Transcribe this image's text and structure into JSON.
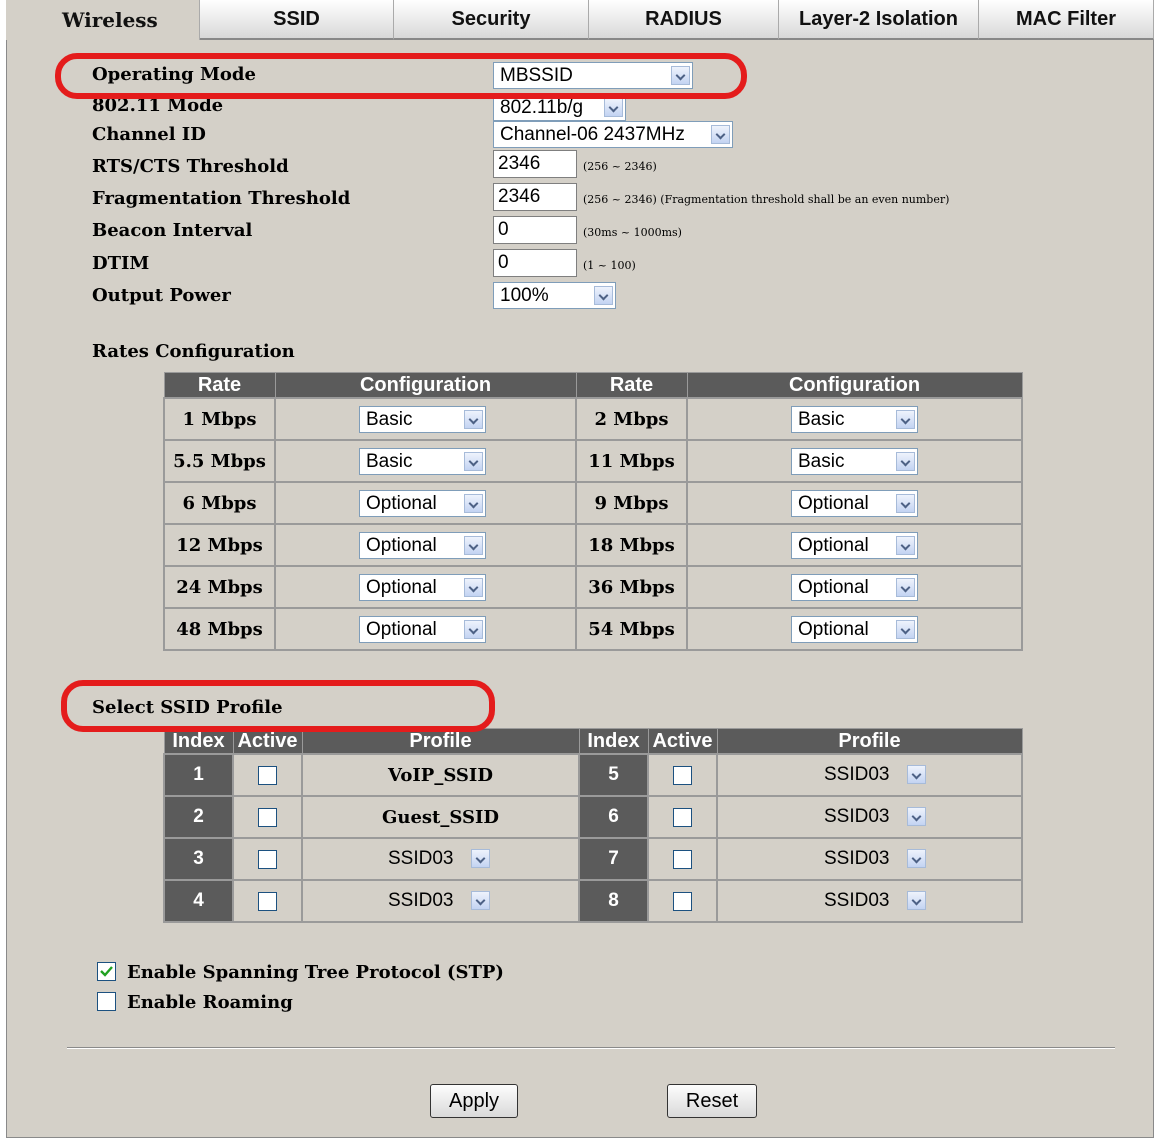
{
  "tabs": [
    "Wireless",
    "SSID",
    "Security",
    "RADIUS",
    "Layer-2 Isolation",
    "MAC Filter"
  ],
  "form": {
    "operating_mode": {
      "label": "Operating Mode",
      "value": "MBSSID"
    },
    "mode_80211": {
      "label": "802.11 Mode",
      "value": "802.11b/g"
    },
    "channel_id": {
      "label": "Channel ID",
      "value": "Channel-06 2437MHz"
    },
    "rts_cts": {
      "label": "RTS/CTS Threshold",
      "value": "2346",
      "hint": "(256 ~ 2346)"
    },
    "fragmentation": {
      "label": "Fragmentation Threshold",
      "value": "2346",
      "hint": "(256 ~ 2346) (Fragmentation threshold shall be an even number)"
    },
    "beacon_interval": {
      "label": "Beacon Interval",
      "value": "0",
      "hint": "(30ms ~ 1000ms)"
    },
    "dtim": {
      "label": "DTIM",
      "value": "0",
      "hint": "(1 ~ 100)"
    },
    "output_power": {
      "label": "Output Power",
      "value": "100%"
    }
  },
  "rates": {
    "title": "Rates Configuration",
    "headers": [
      "Rate",
      "Configuration",
      "Rate",
      "Configuration"
    ],
    "rows": [
      {
        "rate1": "1 Mbps",
        "cfg1": "Basic",
        "rate2": "2 Mbps",
        "cfg2": "Basic"
      },
      {
        "rate1": "5.5 Mbps",
        "cfg1": "Basic",
        "rate2": "11 Mbps",
        "cfg2": "Basic"
      },
      {
        "rate1": "6 Mbps",
        "cfg1": "Optional",
        "rate2": "9 Mbps",
        "cfg2": "Optional"
      },
      {
        "rate1": "12 Mbps",
        "cfg1": "Optional",
        "rate2": "18 Mbps",
        "cfg2": "Optional"
      },
      {
        "rate1": "24 Mbps",
        "cfg1": "Optional",
        "rate2": "36 Mbps",
        "cfg2": "Optional"
      },
      {
        "rate1": "48 Mbps",
        "cfg1": "Optional",
        "rate2": "54 Mbps",
        "cfg2": "Optional"
      }
    ]
  },
  "ssid_profile": {
    "title": "Select SSID Profile",
    "headers": [
      "Index",
      "Active",
      "Profile",
      "Index",
      "Active",
      "Profile"
    ],
    "rows": [
      {
        "i1": "1",
        "p1": "VoIP_SSID",
        "i2": "5",
        "p2": "SSID03"
      },
      {
        "i1": "2",
        "p1": "Guest_SSID",
        "i2": "6",
        "p2": "SSID03"
      },
      {
        "i1": "3",
        "p1": "SSID03",
        "i2": "7",
        "p2": "SSID03"
      },
      {
        "i1": "4",
        "p1": "SSID03",
        "i2": "8",
        "p2": "SSID03"
      }
    ]
  },
  "options": {
    "stp": {
      "label": "Enable Spanning Tree Protocol (STP)",
      "checked": true
    },
    "roaming": {
      "label": "Enable Roaming",
      "checked": false
    }
  },
  "buttons": {
    "apply": "Apply",
    "reset": "Reset"
  },
  "colors": {
    "highlight": "#e41c1c",
    "header_bg": "#5b5b5b",
    "panel_bg": "#d4d0c8"
  }
}
